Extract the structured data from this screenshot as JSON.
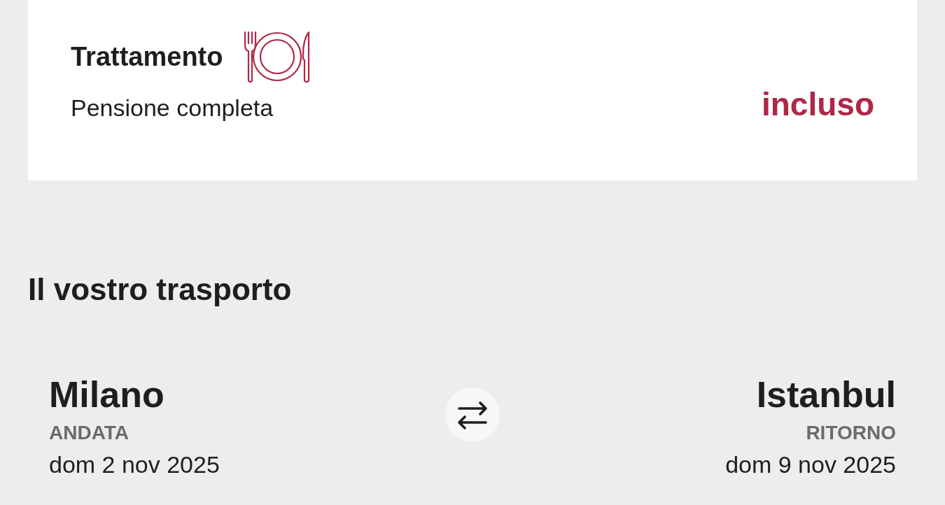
{
  "board": {
    "title": "Trattamento",
    "description": "Pensione completa",
    "price": "incluso"
  },
  "transport": {
    "title": "Il vostro trasporto",
    "legs": [
      {
        "kind": "outbound",
        "city": "Milano",
        "label": "ANDATA",
        "date": "dom 2 nov 2025"
      },
      {
        "kind": "return",
        "city": "Istanbul",
        "label": "RITORNO",
        "date": "dom 9 nov 2025"
      }
    ]
  }
}
